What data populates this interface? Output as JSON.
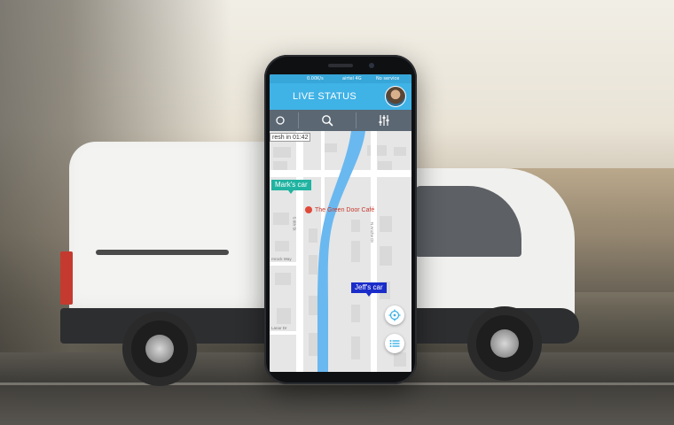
{
  "status_bar": {
    "left": "0.00K/s",
    "carrier": "airtel 4G",
    "right": "No service"
  },
  "app_bar": {
    "title": "LIVE STATUS",
    "avatar_icon": "user-avatar"
  },
  "toolbar": {
    "icons": [
      "back-icon",
      "search-icon",
      "filter-sliders-icon"
    ]
  },
  "map": {
    "refresh_label": "resh in 01:42",
    "markers": [
      {
        "label": "Mark's car",
        "color": "#21b3a1"
      },
      {
        "label": "Jeff's car",
        "color": "#1a2cc9"
      }
    ],
    "poi": {
      "label": "The Green Door Café",
      "icon": "restaurant-pin-icon"
    },
    "streets": [
      "S 6th St",
      "N Anche Dr",
      "rnrock Way",
      "Lanar Dr"
    ],
    "buttons": {
      "locate_icon": "crosshair-icon",
      "list_icon": "list-icon"
    }
  },
  "colors": {
    "app_bar": "#3fb2e6",
    "toolbar": "#5b6773",
    "river": "#6ab8f0"
  }
}
